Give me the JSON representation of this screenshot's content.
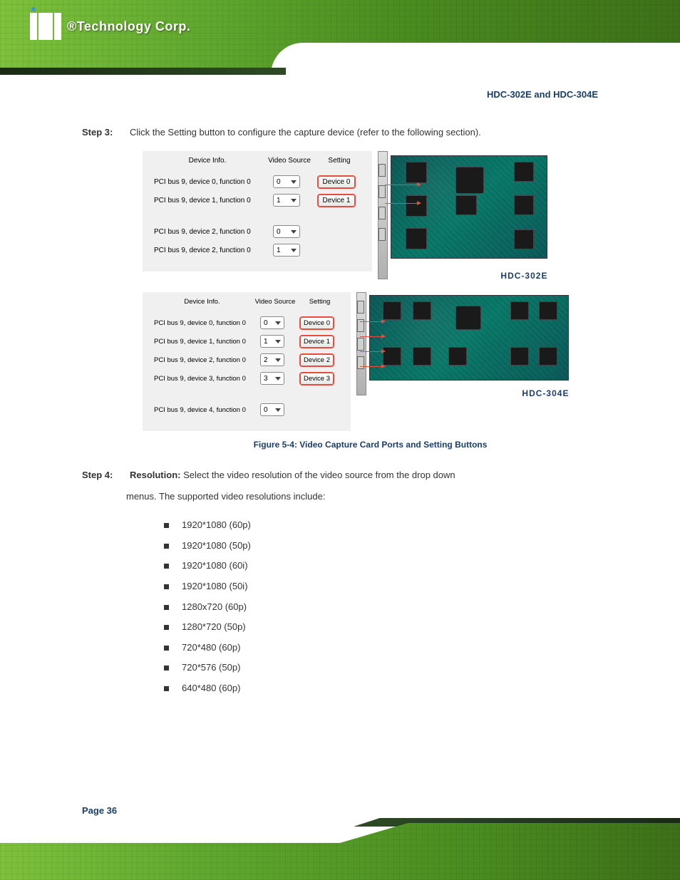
{
  "header": {
    "logo_text": "®Technology Corp.",
    "page_title": "HDC-302E and HDC-304E"
  },
  "content": {
    "step3_label": "Step 3:",
    "step3_text": "Click the Setting button to configure the capture device (refer to the following section).",
    "figure_caption": "Figure 5-4: Video Capture Card Ports and Setting Buttons",
    "step4_label": "Step 4:",
    "step4_text": "Resolution: Select the video resolution of the video source from the drop down",
    "step4_cont": "menus. The supported video resolutions include:",
    "resolutions": [
      "1920*1080 (60p)",
      "1920*1080 (50p)",
      "1920*1080 (60i)",
      "1920*1080 (50i)",
      "1280x720 (60p)",
      "1280*720 (50p)",
      "720*480 (60p)",
      "720*576 (50p)",
      "640*480 (60p)"
    ]
  },
  "panel302": {
    "col_info": "Device Info.",
    "col_source": "Video Source",
    "col_setting": "Setting",
    "rows": [
      {
        "info": "PCI bus 9, device 0, function 0",
        "src": "0",
        "btn": "Device 0"
      },
      {
        "info": "PCI bus 9, device 1, function 0",
        "src": "1",
        "btn": "Device 1"
      },
      {
        "info": "PCI bus 9, device 2, function 0",
        "src": "0",
        "btn": ""
      },
      {
        "info": "PCI bus 9, device 2, function 0",
        "src": "1",
        "btn": ""
      }
    ],
    "board_label": "HDC-302E"
  },
  "panel304": {
    "col_info": "Device Info.",
    "col_source": "Video Source",
    "col_setting": "Setting",
    "rows": [
      {
        "info": "PCI bus 9, device 0, function 0",
        "src": "0",
        "btn": "Device 0"
      },
      {
        "info": "PCI bus 9, device 1, function 0",
        "src": "1",
        "btn": "Device 1"
      },
      {
        "info": "PCI bus 9, device 2, function 0",
        "src": "2",
        "btn": "Device 2"
      },
      {
        "info": "PCI bus 9, device 3, function 0",
        "src": "3",
        "btn": "Device 3"
      },
      {
        "info": "PCI bus 9, device 4, function 0",
        "src": "0",
        "btn": ""
      }
    ],
    "board_label": "HDC-304E"
  },
  "footer": {
    "page_number": "Page 36"
  }
}
